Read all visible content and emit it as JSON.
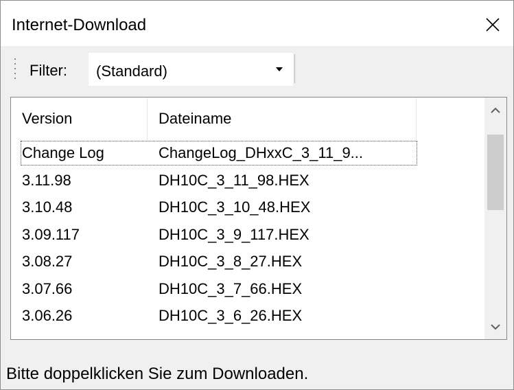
{
  "window": {
    "title": "Internet-Download"
  },
  "toolbar": {
    "filter_label": "Filter:",
    "filter_value": "(Standard)"
  },
  "list": {
    "columns": [
      "Version",
      "Dateiname"
    ],
    "rows": [
      {
        "version": "Change Log",
        "filename": "ChangeLog_DHxxC_3_11_9..."
      },
      {
        "version": "3.11.98",
        "filename": "DH10C_3_11_98.HEX"
      },
      {
        "version": "3.10.48",
        "filename": "DH10C_3_10_48.HEX"
      },
      {
        "version": "3.09.117",
        "filename": "DH10C_3_9_117.HEX"
      },
      {
        "version": "3.08.27",
        "filename": "DH10C_3_8_27.HEX"
      },
      {
        "version": "3.07.66",
        "filename": "DH10C_3_7_66.HEX"
      },
      {
        "version": "3.06.26",
        "filename": "DH10C_3_6_26.HEX"
      }
    ]
  },
  "status": {
    "text": "Bitte doppelklicken Sie zum Downloaden."
  },
  "icons": {
    "close": "close-icon",
    "dropdown": "chevron-down-icon",
    "scroll_up": "chevron-up-icon",
    "scroll_down": "chevron-down-icon"
  }
}
